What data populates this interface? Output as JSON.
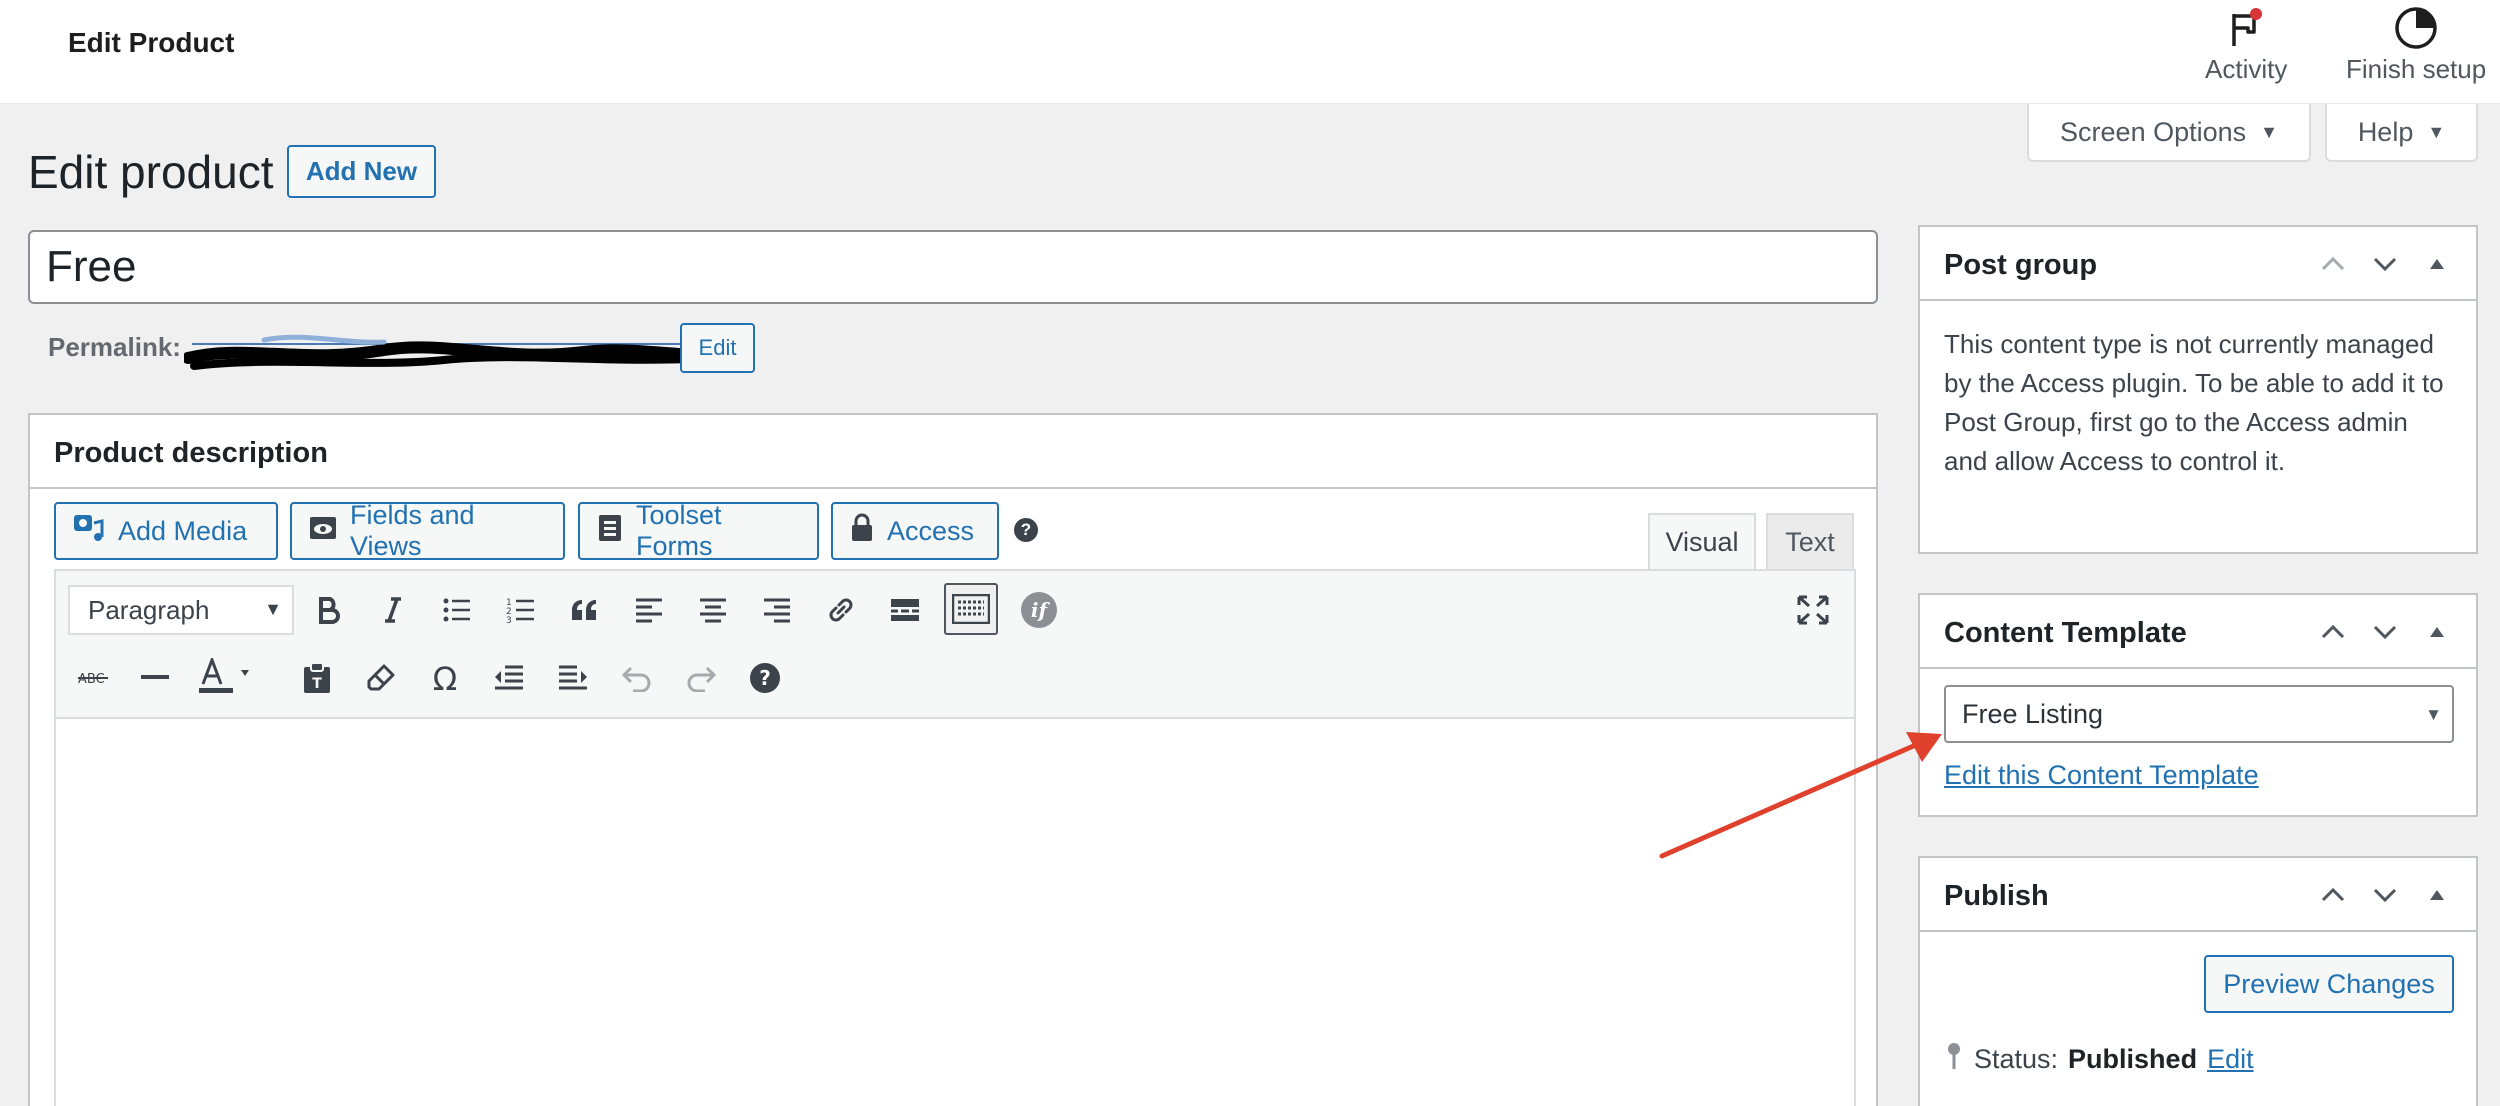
{
  "topbar": {
    "title": "Edit Product",
    "activity_label": "Activity",
    "finish_label": "Finish setup"
  },
  "meta_tabs": {
    "screen_options": "Screen Options",
    "help": "Help"
  },
  "heading": {
    "title": "Edit product",
    "add_new": "Add New"
  },
  "product_title": "Free",
  "permalink": {
    "label": "Permalink:",
    "edit": "Edit"
  },
  "editor": {
    "section_title": "Product description",
    "buttons": {
      "add_media": "Add Media",
      "fields_and_views": "Fields and Views",
      "toolset_forms": "Toolset Forms",
      "access": "Access"
    },
    "tabs": {
      "visual": "Visual",
      "text": "Text"
    },
    "format_select": "Paragraph",
    "help_glyph": "?"
  },
  "sidebar": {
    "post_group": {
      "title": "Post group",
      "body": "This content type is not currently managed by the Access plugin. To be able to add it to Post Group, first go to the Access admin and allow Access to control it."
    },
    "content_template": {
      "title": "Content Template",
      "selected": "Free Listing",
      "edit_link": "Edit this Content Template"
    },
    "publish": {
      "title": "Publish",
      "preview": "Preview Changes",
      "status_label": "Status:",
      "status_value": "Published",
      "status_edit": "Edit"
    }
  },
  "colors": {
    "accent": "#2271b1",
    "arrow": "#e0412c",
    "notification_dot": "#d63638"
  },
  "icons": {
    "activity": "flag-icon",
    "finish": "progress-circle-icon",
    "add_media": "camera-music-icon",
    "fields": "eye-icon",
    "forms": "form-icon",
    "access": "lock-icon"
  }
}
